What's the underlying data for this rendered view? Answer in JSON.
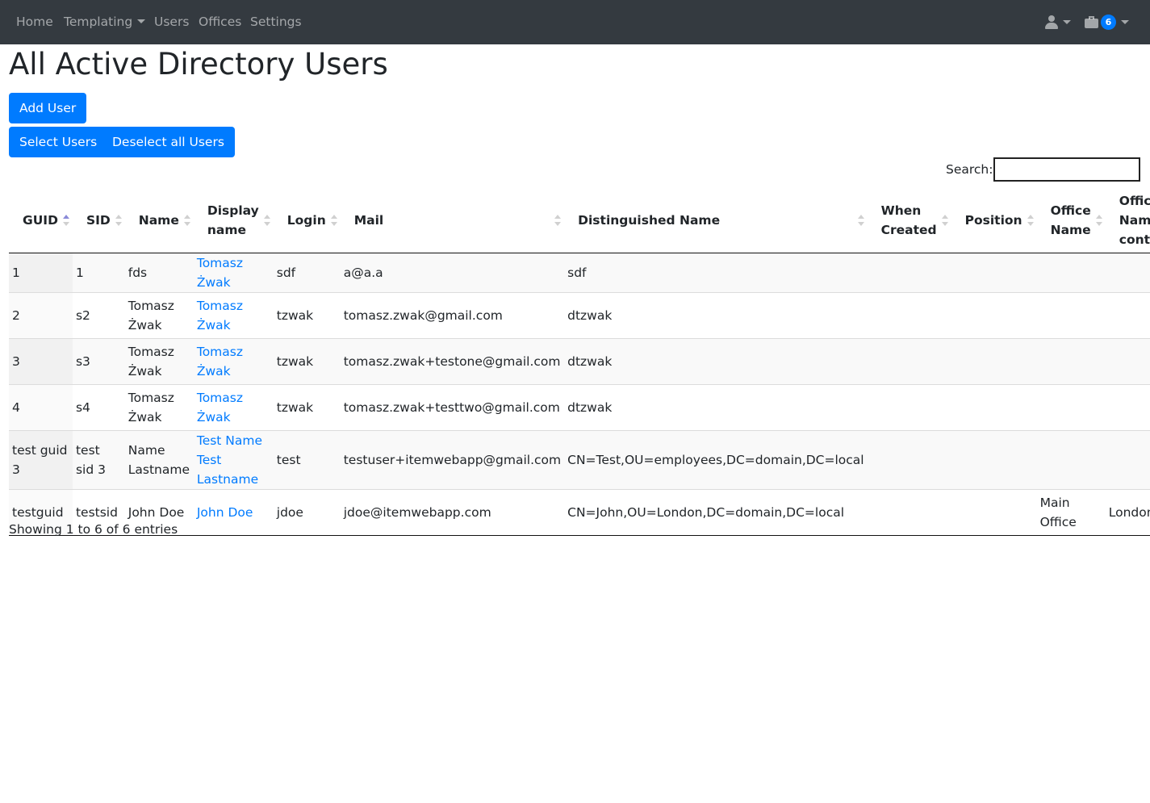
{
  "nav": {
    "home": "Home",
    "templating": "Templating",
    "users": "Users",
    "offices": "Offices",
    "settings": "Settings",
    "badge_count": "6"
  },
  "page_title": "All Active Directory Users",
  "buttons": {
    "add_user": "Add User",
    "select_users": "Select Users",
    "deselect_all": "Deselect all Users"
  },
  "search": {
    "label": "Search:",
    "value": ""
  },
  "table": {
    "headers": {
      "guid": "GUID",
      "sid": "SID",
      "name": "Name",
      "display_name": "Display name",
      "login": "Login",
      "mail": "Mail",
      "dn": "Distinguished Name",
      "when_created": "When Created",
      "position": "Position",
      "office_name": "Office Name",
      "office_name_cont": "Office Name cont."
    },
    "rows": [
      {
        "guid": "1",
        "sid": "1",
        "name": "fds",
        "display_name": "Tomasz Żwak",
        "login": "sdf",
        "mail": "a@a.a",
        "dn": "sdf",
        "when_created": "",
        "position": "",
        "office_name": "",
        "office_name_cont": ""
      },
      {
        "guid": "2",
        "sid": "s2",
        "name": "Tomasz Żwak",
        "display_name": "Tomasz Żwak",
        "login": "tzwak",
        "mail": "tomasz.zwak@gmail.com",
        "dn": "dtzwak",
        "when_created": "",
        "position": "",
        "office_name": "",
        "office_name_cont": ""
      },
      {
        "guid": "3",
        "sid": "s3",
        "name": "Tomasz Żwak",
        "display_name": "Tomasz Żwak",
        "login": "tzwak",
        "mail": "tomasz.zwak+testone@gmail.com",
        "dn": "dtzwak",
        "when_created": "",
        "position": "",
        "office_name": "",
        "office_name_cont": ""
      },
      {
        "guid": "4",
        "sid": "s4",
        "name": "Tomasz Żwak",
        "display_name": "Tomasz Żwak",
        "login": "tzwak",
        "mail": "tomasz.zwak+testtwo@gmail.com",
        "dn": "dtzwak",
        "when_created": "",
        "position": "",
        "office_name": "",
        "office_name_cont": ""
      },
      {
        "guid": "test guid 3",
        "sid": "test sid 3",
        "name": "Name Lastname",
        "display_name": "Test Name Test Lastname",
        "login": "test",
        "mail": "testuser+itemwebapp@gmail.com",
        "dn": "CN=Test,OU=employees,DC=domain,DC=local",
        "when_created": "",
        "position": "",
        "office_name": "",
        "office_name_cont": ""
      },
      {
        "guid": "testguid",
        "sid": "testsid",
        "name": "John Doe",
        "display_name": "John Doe",
        "login": "jdoe",
        "mail": "jdoe@itemwebapp.com",
        "dn": "CN=John,OU=London,DC=domain,DC=local",
        "when_created": "",
        "position": "",
        "office_name": "Main Office",
        "office_name_cont": "London"
      }
    ]
  },
  "footer_info": "Showing 1 to 6 of 6 entries"
}
